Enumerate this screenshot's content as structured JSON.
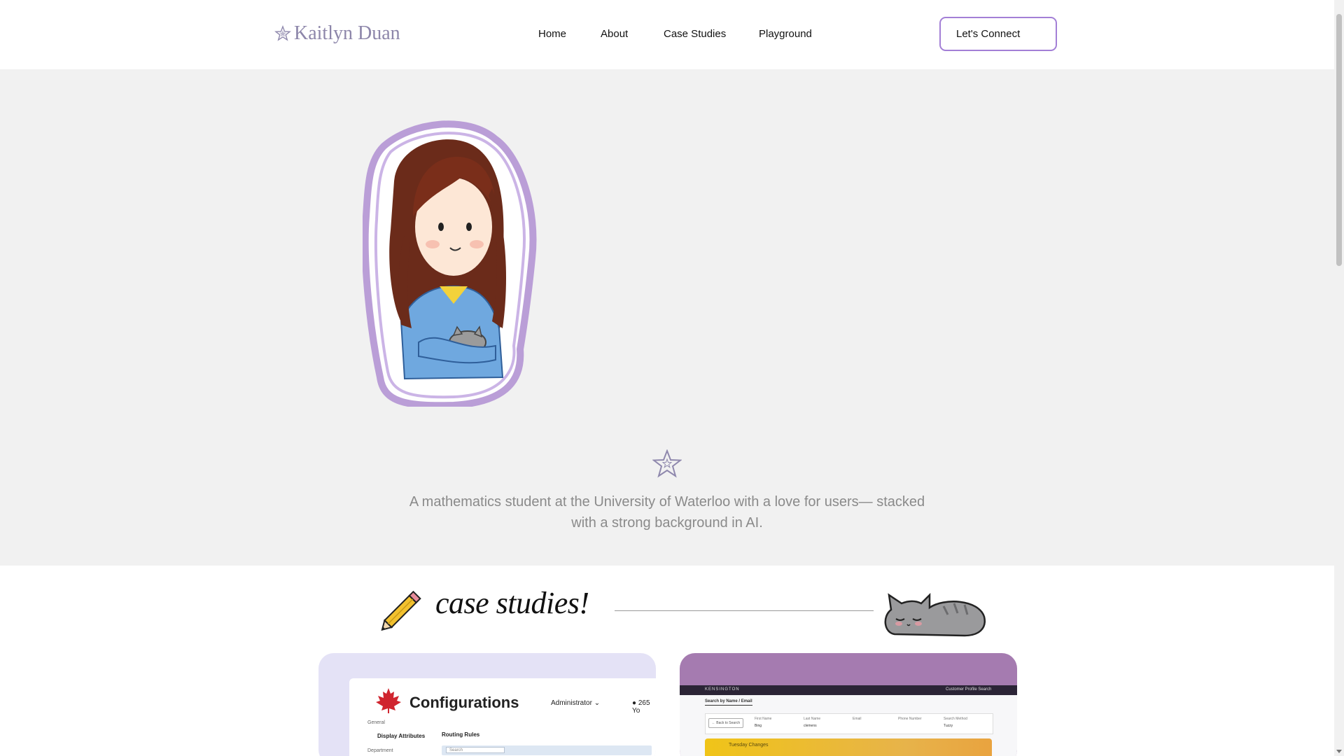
{
  "header": {
    "logo_text": "Kaitlyn Duan",
    "nav": [
      "Home",
      "About",
      "Case Studies",
      "Playground"
    ],
    "cta_label": "Let's Connect"
  },
  "hero": {
    "tagline": "A mathematics student at the University of Waterloo with a love for users— stacked with a strong background in AI."
  },
  "case_studies": {
    "title": "case studies!",
    "cards": [
      {
        "screen_title": "Configurations",
        "role": "Administrator",
        "location": "265 Yo",
        "general_label": "General",
        "display_attributes": "Display Attributes",
        "department_label": "Department",
        "routing_rules": "Routing Rules",
        "search_placeholder": "Search"
      },
      {
        "brand": "KENSINGTON",
        "profile_title": "Customer Profile Search",
        "tab": "Search by Name / Email",
        "back_label": "← Back to Search",
        "fields": [
          {
            "label": "First Name",
            "value": "Bing"
          },
          {
            "label": "Last Name",
            "value": "clemens"
          },
          {
            "label": "Email",
            "value": ""
          },
          {
            "label": "Phone Number",
            "value": ""
          },
          {
            "label": "Search Method",
            "value": "Tuzzy"
          }
        ],
        "banner_text": "Tuesday Changes"
      }
    ]
  },
  "colors": {
    "accent": "#a37fd6",
    "hero_bg": "#f1f1f1",
    "card1_bg": "#e4e2f6",
    "card2_bg": "#a57bb0"
  },
  "icons": [
    "star-logo-icon",
    "star-divider-icon",
    "pencil-icon",
    "sleeping-cat-icon",
    "maple-leaf-icon",
    "chevron-down-icon",
    "location-pin-icon"
  ]
}
